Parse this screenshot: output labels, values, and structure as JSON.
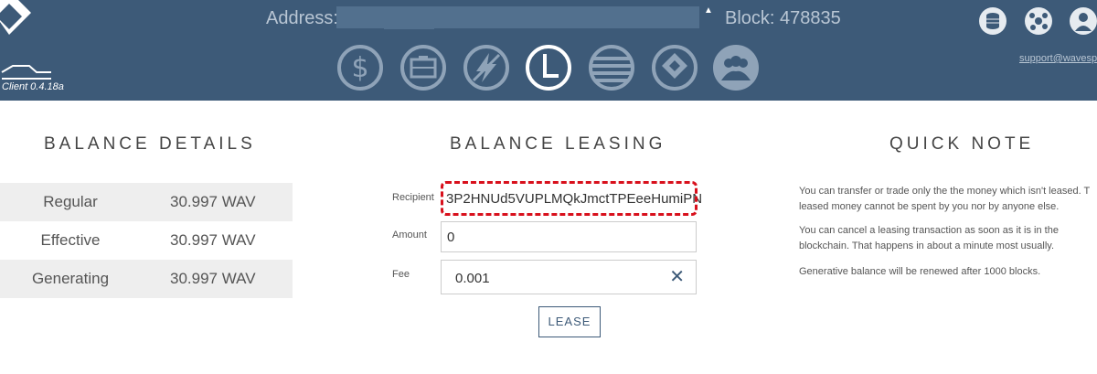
{
  "header": {
    "client_version": "Client 0.4.18a",
    "address_label": "Address:",
    "block_label": "Block: 478835",
    "support_link": "support@wavesp",
    "nav_icons": [
      "dollar-icon",
      "wallet-icon",
      "trading-icon",
      "leasing-icon",
      "history-icon",
      "dex-icon",
      "community-icon"
    ],
    "right_icons": [
      "database-icon",
      "network-icon",
      "settings-icon"
    ]
  },
  "balance_details": {
    "title": "BALANCE DETAILS",
    "rows": [
      {
        "label": "Regular",
        "value": "30.997 WAV"
      },
      {
        "label": "Effective",
        "value": "30.997 WAV"
      },
      {
        "label": "Generating",
        "value": "30.997 WAV"
      }
    ]
  },
  "leasing": {
    "title": "BALANCE LEASING",
    "recipient_label": "Recipient",
    "recipient_value": "3P2HNUd5VUPLMQkJmctTPEeeHumiPN",
    "amount_label": "Amount",
    "amount_value": "0",
    "fee_label": "Fee",
    "fee_value": "0.001",
    "lease_button": "LEASE"
  },
  "quick_note": {
    "title": "QUICK NOTE",
    "lines": [
      "You can transfer or trade only the the money which isn't leased. T",
      "leased money cannot be spent by you nor by anyone else.",
      "You can cancel a leasing transaction as soon as it is in the",
      "blockchain. That happens in about a minute most usually.",
      "Generative balance will be renewed after 1000 blocks."
    ]
  },
  "colors": {
    "header_bg": "#3d5a78",
    "accent": "#3d5a78",
    "highlight": "#d8101c"
  }
}
